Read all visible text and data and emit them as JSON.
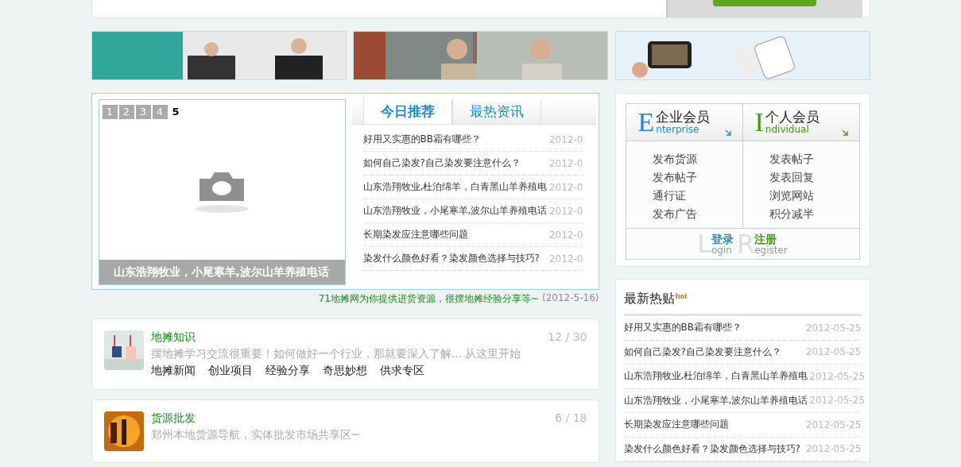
{
  "slider": {
    "pages": [
      {
        "label": "1",
        "selected": false
      },
      {
        "label": "2",
        "selected": false
      },
      {
        "label": "3",
        "selected": false
      },
      {
        "label": "4",
        "selected": false
      },
      {
        "label": "5",
        "selected": true
      }
    ],
    "caption": "山东浩翔牧业，小尾寒羊,波尔山羊养殖电话"
  },
  "news_tabs": [
    {
      "label": "今日推荐",
      "selected": true
    },
    {
      "label": "最热资讯",
      "selected": false
    }
  ],
  "news": [
    {
      "title": "好用又实惠的BB霜有哪些？",
      "date": "2012-0"
    },
    {
      "title": "如何自己染发?自己染发要注意什么？",
      "date": "2012-0"
    },
    {
      "title": "山东浩翔牧业,杜泊绵羊，白青黑山羊养殖电",
      "date": "2012-0"
    },
    {
      "title": "山东浩翔牧业，小尾寒羊,波尔山羊养殖电话",
      "date": "2012-0"
    },
    {
      "title": "长期染发应注意哪些问题",
      "date": "2012-0"
    },
    {
      "title": "染发什么颜色好看？染发颜色选择与技巧?",
      "date": "2012-0"
    }
  ],
  "tagline": {
    "text": "71地摊网为你提供进货资源，很摆地摊经验分享等~",
    "date": "(2012-5-16)"
  },
  "sections": [
    {
      "title": "地摊知识",
      "count": "12 / 30",
      "description": "摆地摊学习交流很重要！如何做好一个行业，那就要深入了解... 从这里开始",
      "links": [
        "地摊新闻",
        "创业项目",
        "经验分享",
        "奇思妙想",
        "供求专区"
      ]
    },
    {
      "title": "货源批发",
      "count": "6 / 18",
      "description": "郑州本地货源导航，实体批发市场共享区~"
    }
  ],
  "members": [
    {
      "letter": "E",
      "title": "企业会员",
      "sub": "nterprise",
      "color": "#1a8ccf",
      "actions": [
        "发布货源",
        "发布帖子",
        "通行证",
        "发布广告"
      ]
    },
    {
      "letter": "I",
      "title": "个人会员",
      "sub": "ndividual",
      "color": "#3f9a1b",
      "actions": [
        "发表帖子",
        "发表回复",
        "浏览网站",
        "积分减半"
      ]
    }
  ],
  "auth": [
    {
      "letter": "L",
      "sub": "ogin",
      "label": "登录",
      "color": "#1a8ccf"
    },
    {
      "letter": "R",
      "sub": "egister",
      "label": "注册",
      "color": "#3f9a1b"
    }
  ],
  "hot": {
    "title": "最新热贴",
    "badge": "hot",
    "items": [
      {
        "title": "好用又实惠的BB霜有哪些？",
        "date": "2012-05-25"
      },
      {
        "title": "如何自己染发?自己染发要注意什么？",
        "date": "2012-05-25"
      },
      {
        "title": "山东浩翔牧业,杜泊绵羊，白青黑山羊养殖电",
        "date": "2012-05-25"
      },
      {
        "title": "山东浩翔牧业，小尾寒羊,波尔山羊养殖电话",
        "date": "2012-05-25"
      },
      {
        "title": "长期染发应注意哪些问题",
        "date": "2012-05-25"
      },
      {
        "title": "染发什么颜色好看？染发颜色选择与技巧?",
        "date": "2012-05-25"
      }
    ]
  }
}
